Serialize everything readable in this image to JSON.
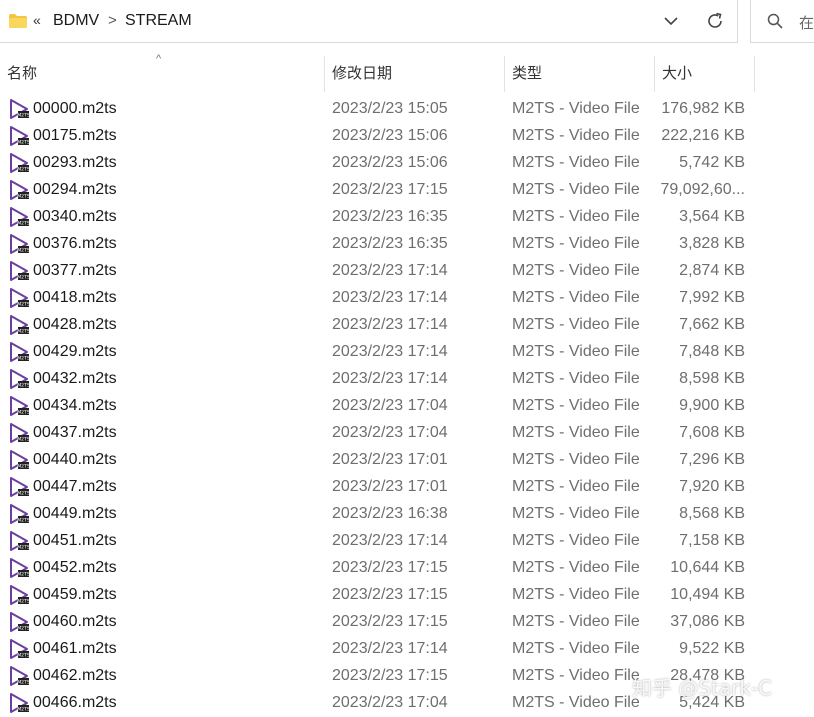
{
  "address": {
    "overflow_label": "«",
    "crumbs": [
      "BDMV",
      "STREAM"
    ],
    "separator": ">"
  },
  "search": {
    "placeholder": "在"
  },
  "columns": {
    "name": "名称",
    "date": "修改日期",
    "type": "类型",
    "size": "大小"
  },
  "sort_indicator": "^",
  "files": [
    {
      "name": "00000.m2ts",
      "date": "2023/2/23 15:05",
      "type": "M2TS - Video File",
      "size": "176,982 KB"
    },
    {
      "name": "00175.m2ts",
      "date": "2023/2/23 15:06",
      "type": "M2TS - Video File",
      "size": "222,216 KB"
    },
    {
      "name": "00293.m2ts",
      "date": "2023/2/23 15:06",
      "type": "M2TS - Video File",
      "size": "5,742 KB"
    },
    {
      "name": "00294.m2ts",
      "date": "2023/2/23 17:15",
      "type": "M2TS - Video File",
      "size": "79,092,60..."
    },
    {
      "name": "00340.m2ts",
      "date": "2023/2/23 16:35",
      "type": "M2TS - Video File",
      "size": "3,564 KB"
    },
    {
      "name": "00376.m2ts",
      "date": "2023/2/23 16:35",
      "type": "M2TS - Video File",
      "size": "3,828 KB"
    },
    {
      "name": "00377.m2ts",
      "date": "2023/2/23 17:14",
      "type": "M2TS - Video File",
      "size": "2,874 KB"
    },
    {
      "name": "00418.m2ts",
      "date": "2023/2/23 17:14",
      "type": "M2TS - Video File",
      "size": "7,992 KB"
    },
    {
      "name": "00428.m2ts",
      "date": "2023/2/23 17:14",
      "type": "M2TS - Video File",
      "size": "7,662 KB"
    },
    {
      "name": "00429.m2ts",
      "date": "2023/2/23 17:14",
      "type": "M2TS - Video File",
      "size": "7,848 KB"
    },
    {
      "name": "00432.m2ts",
      "date": "2023/2/23 17:14",
      "type": "M2TS - Video File",
      "size": "8,598 KB"
    },
    {
      "name": "00434.m2ts",
      "date": "2023/2/23 17:04",
      "type": "M2TS - Video File",
      "size": "9,900 KB"
    },
    {
      "name": "00437.m2ts",
      "date": "2023/2/23 17:04",
      "type": "M2TS - Video File",
      "size": "7,608 KB"
    },
    {
      "name": "00440.m2ts",
      "date": "2023/2/23 17:01",
      "type": "M2TS - Video File",
      "size": "7,296 KB"
    },
    {
      "name": "00447.m2ts",
      "date": "2023/2/23 17:01",
      "type": "M2TS - Video File",
      "size": "7,920 KB"
    },
    {
      "name": "00449.m2ts",
      "date": "2023/2/23 16:38",
      "type": "M2TS - Video File",
      "size": "8,568 KB"
    },
    {
      "name": "00451.m2ts",
      "date": "2023/2/23 17:14",
      "type": "M2TS - Video File",
      "size": "7,158 KB"
    },
    {
      "name": "00452.m2ts",
      "date": "2023/2/23 17:15",
      "type": "M2TS - Video File",
      "size": "10,644 KB"
    },
    {
      "name": "00459.m2ts",
      "date": "2023/2/23 17:15",
      "type": "M2TS - Video File",
      "size": "10,494 KB"
    },
    {
      "name": "00460.m2ts",
      "date": "2023/2/23 17:15",
      "type": "M2TS - Video File",
      "size": "37,086 KB"
    },
    {
      "name": "00461.m2ts",
      "date": "2023/2/23 17:14",
      "type": "M2TS - Video File",
      "size": "9,522 KB"
    },
    {
      "name": "00462.m2ts",
      "date": "2023/2/23 17:15",
      "type": "M2TS - Video File",
      "size": "28,478 KB"
    },
    {
      "name": "00466.m2ts",
      "date": "2023/2/23 17:04",
      "type": "M2TS - Video File",
      "size": "5,424 KB"
    }
  ],
  "watermark": "知乎 @Stark-C",
  "icons": {
    "folder": "folder-icon",
    "dropdown": "chevron-down-icon",
    "refresh": "refresh-icon",
    "search": "search-icon",
    "file": "video-file-icon"
  },
  "colors": {
    "folder": "#f4c542",
    "video_icon": "#6a3fa0",
    "secondary_text": "#6e6e6e"
  }
}
